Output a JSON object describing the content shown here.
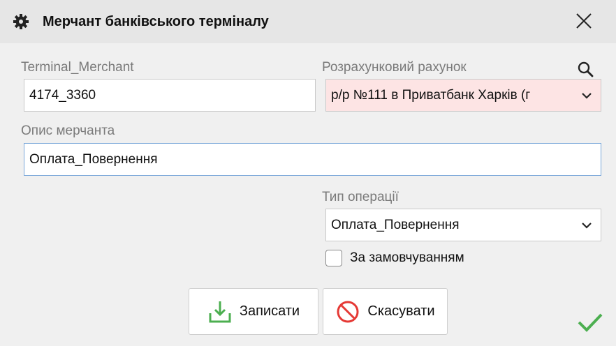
{
  "dialog": {
    "title": "Мерчант банківського терміналу",
    "icons": {
      "title": "gear-icon",
      "close": "close-icon",
      "search": "search-icon",
      "status": "checkmark-icon"
    }
  },
  "form": {
    "terminal_merchant": {
      "label": "Terminal_Merchant",
      "value": "4174_3360"
    },
    "account": {
      "label": "Розрахунковий рахунок",
      "value": "р/р №111 в Приватбанк Харків (г",
      "highlight_color": "#fde4e4"
    },
    "description": {
      "label": "Опис мерчанта",
      "value": "Оплата_Повернення"
    },
    "operation_type": {
      "label": "Тип операції",
      "value": "Оплата_Повернення"
    },
    "default_checkbox": {
      "label": "За замовчуванням",
      "checked": false
    }
  },
  "buttons": {
    "save": {
      "label": "Записати",
      "color": "#4caf50"
    },
    "cancel": {
      "label": "Скасувати",
      "color": "#e53935"
    }
  }
}
